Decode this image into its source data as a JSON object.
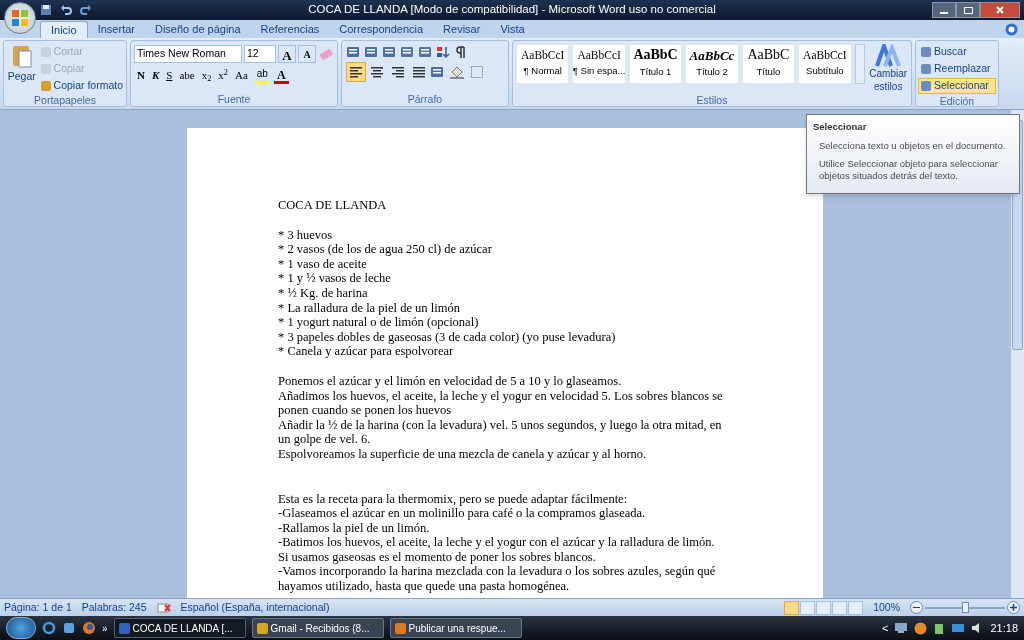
{
  "window": {
    "title": "COCA DE LLANDA [Modo de compatibilidad] - Microsoft Word uso no comercial"
  },
  "tabs": [
    {
      "label": "Inicio",
      "selected": true
    },
    {
      "label": "Insertar",
      "selected": false
    },
    {
      "label": "Diseño de página",
      "selected": false
    },
    {
      "label": "Referencias",
      "selected": false
    },
    {
      "label": "Correspondencia",
      "selected": false
    },
    {
      "label": "Revisar",
      "selected": false
    },
    {
      "label": "Vista",
      "selected": false
    }
  ],
  "clipboard": {
    "label": "Portapapeles",
    "paste": "Pegar",
    "items": [
      {
        "label": "Cortar",
        "disabled": true
      },
      {
        "label": "Copiar",
        "disabled": true
      },
      {
        "label": "Copiar formato",
        "disabled": false
      }
    ]
  },
  "font": {
    "label": "Fuente",
    "font_name": "Times New Roman",
    "font_size": "12",
    "grow": "A",
    "shrink": "A",
    "buttons": [
      "N",
      "K",
      "S",
      "abe",
      "x$_{2}$",
      "x$^{2}$",
      "Aa"
    ],
    "highlight": "ab",
    "color_label": "A"
  },
  "paragraph": {
    "label": "Párrafo",
    "alignments": [
      {
        "selected": true
      },
      {
        "selected": false
      },
      {
        "selected": false
      },
      {
        "selected": false
      }
    ]
  },
  "styles": {
    "label": "Estilos",
    "items": [
      {
        "sample": "AaBbCcI",
        "name": "¶ Normal",
        "kind": "normal"
      },
      {
        "sample": "AaBbCcI",
        "name": "¶ Sin espa...",
        "kind": "normal"
      },
      {
        "sample": "AaBbC",
        "name": "Título 1",
        "kind": "heading"
      },
      {
        "sample": "AaBbCc",
        "name": "Título 2",
        "kind": "italic"
      },
      {
        "sample": "AaBbC",
        "name": "Título",
        "kind": "title"
      },
      {
        "sample": "AaBbCcI",
        "name": "Subtítulo",
        "kind": "normal"
      }
    ],
    "change": "Cambiar estilos"
  },
  "editing": {
    "label": "Edición",
    "items": [
      {
        "label": "Buscar",
        "selected": false
      },
      {
        "label": "Reemplazar",
        "selected": false
      },
      {
        "label": "Seleccionar",
        "selected": true
      }
    ]
  },
  "tooltip": {
    "title": "Seleccionar",
    "lines": [
      "Selecciona texto u objetos en el documento.",
      "Utilice Seleccionar objeto para seleccionar objetos situados detrás del texto."
    ]
  },
  "document": {
    "blocks": [
      [
        "COCA DE LLANDA"
      ],
      [
        "* 3 huevos",
        "* 2 vasos (de los de agua 250 cl) de azúcar",
        "* 1 vaso de aceite",
        "* 1 y ½ vasos de leche",
        "* ½ Kg. de harina",
        "* La ralladura de la piel de un limón",
        "* 1 yogurt natural o de limón (opcional)",
        "* 3 papeles dobles de gaseosas (3 de cada color) (yo puse levadura)",
        "* Canela y azúcar para espolvorear"
      ],
      [
        "Ponemos el azúcar y el limón en velocidad de 5 a 10 y lo glaseamos.",
        "Añadimos los huevos, el aceite, la leche y el yogur en velocidad 5. Los sobres blancos se ponen cuando se ponen los huevos",
        "Añadir la ½ de la harina (con la levadura) vel. 5 unos segundos, y luego la otra mitad, en un golpe de vel. 6.",
        "Espolvoreamos la superficie de una mezcla de canela y azúcar y al horno."
      ],
      [
        "Esta es la receta para la thermomix, pero se puede adaptar fácilmente:",
        "-Glaseamos el azúcar en un molinillo  para café o la compramos  glaseada.",
        "-Rallamos la piel de un limón.",
        "-Batimos los huevos, el aceite, la leche y el yogur con el azúcar y la ralladura de limón. Si usamos gaseosas es el momento de poner los sobres blancos.",
        "-Vamos incorporando la harina mezclada con la levadura o los sobres azules, según qué hayamos utilizado, hasta que quede una pasta homogénea."
      ]
    ]
  },
  "status_bar": {
    "page": "Página: 1 de 1",
    "words": "Palabras: 245",
    "language": "Español (España, internacional)",
    "views": [
      {
        "selected": true
      },
      {
        "selected": false
      },
      {
        "selected": false
      },
      {
        "selected": false
      },
      {
        "selected": false
      }
    ],
    "zoom": "100%",
    "zoom_slider": {
      "level": 0.5
    }
  },
  "taskbar": {
    "more": "»",
    "tasks": [
      {
        "label": "COCA DE LLANDA [...",
        "selected": true,
        "kind": "word"
      },
      {
        "label": "Gmail - Recibidos (8...",
        "selected": false,
        "kind": "chrome"
      },
      {
        "label": "Publicar una respue...",
        "selected": false,
        "kind": "firefox"
      }
    ],
    "tray_arrow": "<",
    "time": "21:18"
  }
}
